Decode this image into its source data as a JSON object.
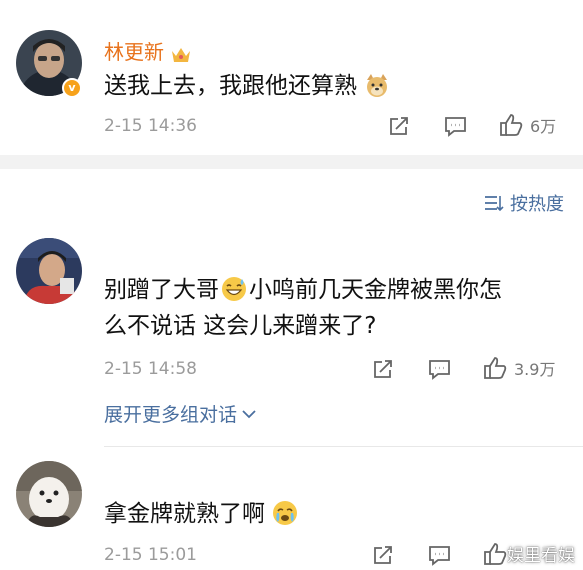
{
  "comment1": {
    "username": "林更新",
    "content": "送我上去，我跟他还算熟",
    "time": "2-15 14:36",
    "likes": "6万"
  },
  "sort": {
    "label": "按热度"
  },
  "comment2": {
    "username": "",
    "content_line1": "别蹭了大哥",
    "content_line1b": "小鸣前几天金牌被黑你怎",
    "content_line2": "么不说话 这会儿来蹭来了?",
    "time": "2-15 14:58",
    "likes": "3.9万",
    "expand_label": "展开更多组对话"
  },
  "comment3": {
    "username": "",
    "content": "拿金牌就熟了啊",
    "time": "2-15 15:01"
  },
  "watermark": "娱里看娱",
  "colors": {
    "username": "#e8731d",
    "link": "#4a6f9f",
    "badge": "#f7a21b"
  }
}
